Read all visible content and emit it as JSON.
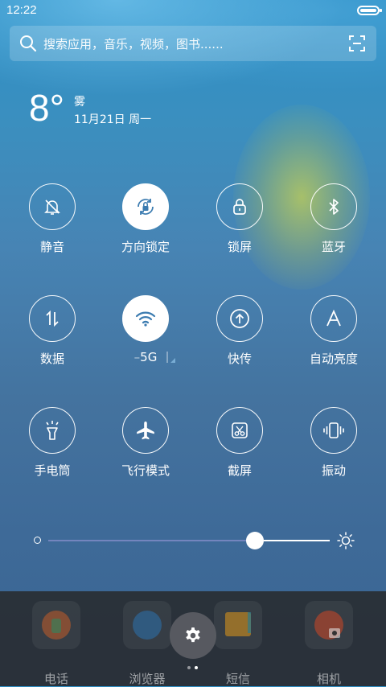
{
  "status_bar": {
    "time": "12:22"
  },
  "search": {
    "placeholder": "搜索应用，音乐，视频，图书......"
  },
  "weather": {
    "temperature": "8°",
    "condition": "雾",
    "date": "11月21日 周一"
  },
  "toggles": [
    {
      "label": "静音",
      "icon": "bell-off-icon",
      "on": false
    },
    {
      "label": "方向锁定",
      "icon": "rotation-lock-icon",
      "on": true
    },
    {
      "label": "锁屏",
      "icon": "lock-icon",
      "on": false
    },
    {
      "label": "蓝牙",
      "icon": "bluetooth-icon",
      "on": false
    },
    {
      "label": "数据",
      "icon": "data-arrows-icon",
      "on": false
    },
    {
      "label": "5G",
      "icon": "wifi-icon",
      "on": true
    },
    {
      "label": "快传",
      "icon": "upload-icon",
      "on": false
    },
    {
      "label": "自动亮度",
      "icon": "auto-brightness-icon",
      "on": false
    },
    {
      "label": "手电筒",
      "icon": "flashlight-icon",
      "on": false
    },
    {
      "label": "飞行模式",
      "icon": "airplane-icon",
      "on": false
    },
    {
      "label": "截屏",
      "icon": "screenshot-icon",
      "on": false
    },
    {
      "label": "振动",
      "icon": "vibrate-icon",
      "on": false
    }
  ],
  "brightness": {
    "level": 0.72
  },
  "dock": {
    "apps": [
      {
        "label": "电话",
        "icon": "phone-app-icon"
      },
      {
        "label": "浏览器",
        "icon": "browser-app-icon"
      },
      {
        "label": "短信",
        "icon": "messages-app-icon"
      },
      {
        "label": "相机",
        "icon": "camera-app-icon"
      }
    ]
  },
  "pager": {
    "pages": 2,
    "current": 1
  },
  "colors": {
    "accent_on": "#ffffff",
    "toggle_on_icon": "#3b7bb0",
    "dock_bg": "#28292e"
  }
}
